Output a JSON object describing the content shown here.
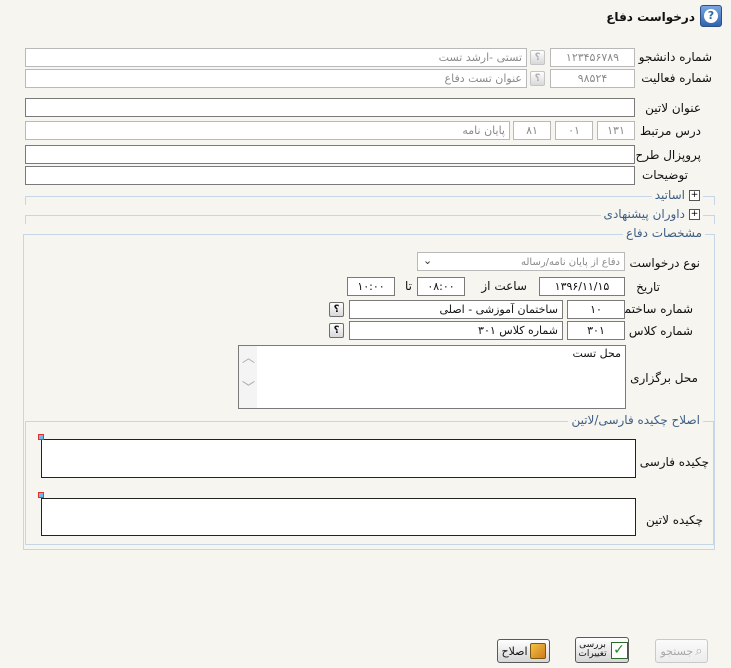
{
  "page": {
    "title": "درخواست دفاع",
    "help_icon": "help-icon"
  },
  "student": {
    "label": "شماره دانشجو",
    "number": "۱۲۳۴۵۶۷۸۹",
    "name": "تستی -ارشد تست"
  },
  "activity": {
    "label": "شماره فعالیت",
    "number": "۹۸۵۲۴",
    "title": "عنوان تست دفاع"
  },
  "latin_title": {
    "label": "عنوان لاتین",
    "value": ""
  },
  "course": {
    "label": "درس مرتبط",
    "code1": "۱۳۱",
    "code2": "۰۱",
    "code3": "۸۱",
    "name": "پایان نامه"
  },
  "proposal": {
    "label": "پروپزال طرح",
    "value": ""
  },
  "notes": {
    "label": "توضیحات",
    "value": ""
  },
  "sections": {
    "professors": "اساتید",
    "judges": "داوران پیشنهادی"
  },
  "defense": {
    "legend": "مشخصات دفاع",
    "request_type_label": "نوع درخواست",
    "request_type_value": "دفاع از پایان نامه/رساله",
    "date_label": "تاریخ",
    "date_value": "۱۳۹۶/۱۱/۱۵",
    "time_from_label": "ساعت از",
    "time_from": "۰۸:۰۰",
    "time_to_label": "تا",
    "time_to": "۱۰:۰۰",
    "building_label": "شماره ساختمان",
    "building_number": "۱۰",
    "building_name": "ساختمان آموزشی - اصلی",
    "class_label": "شماره کلاس",
    "class_number": "۳۰۱",
    "class_name": "شماره کلاس ۳۰۱",
    "venue_label": "محل برگزاری",
    "venue_value": "محل تست"
  },
  "abstract": {
    "legend": "اصلاح چکیده فارسی/لاتین",
    "persian_label": "چکیده فارسی",
    "latin_label": "چکیده لاتین"
  },
  "toolbar": {
    "correct": "اصلاح",
    "review": "بررسی تغییرات",
    "search": "جستجو"
  },
  "colors": {
    "legend": "#3f5f84",
    "fieldset_border": "#c6d6e6",
    "help_icon": "#2f63b0",
    "handle": "#6fb5e8"
  }
}
